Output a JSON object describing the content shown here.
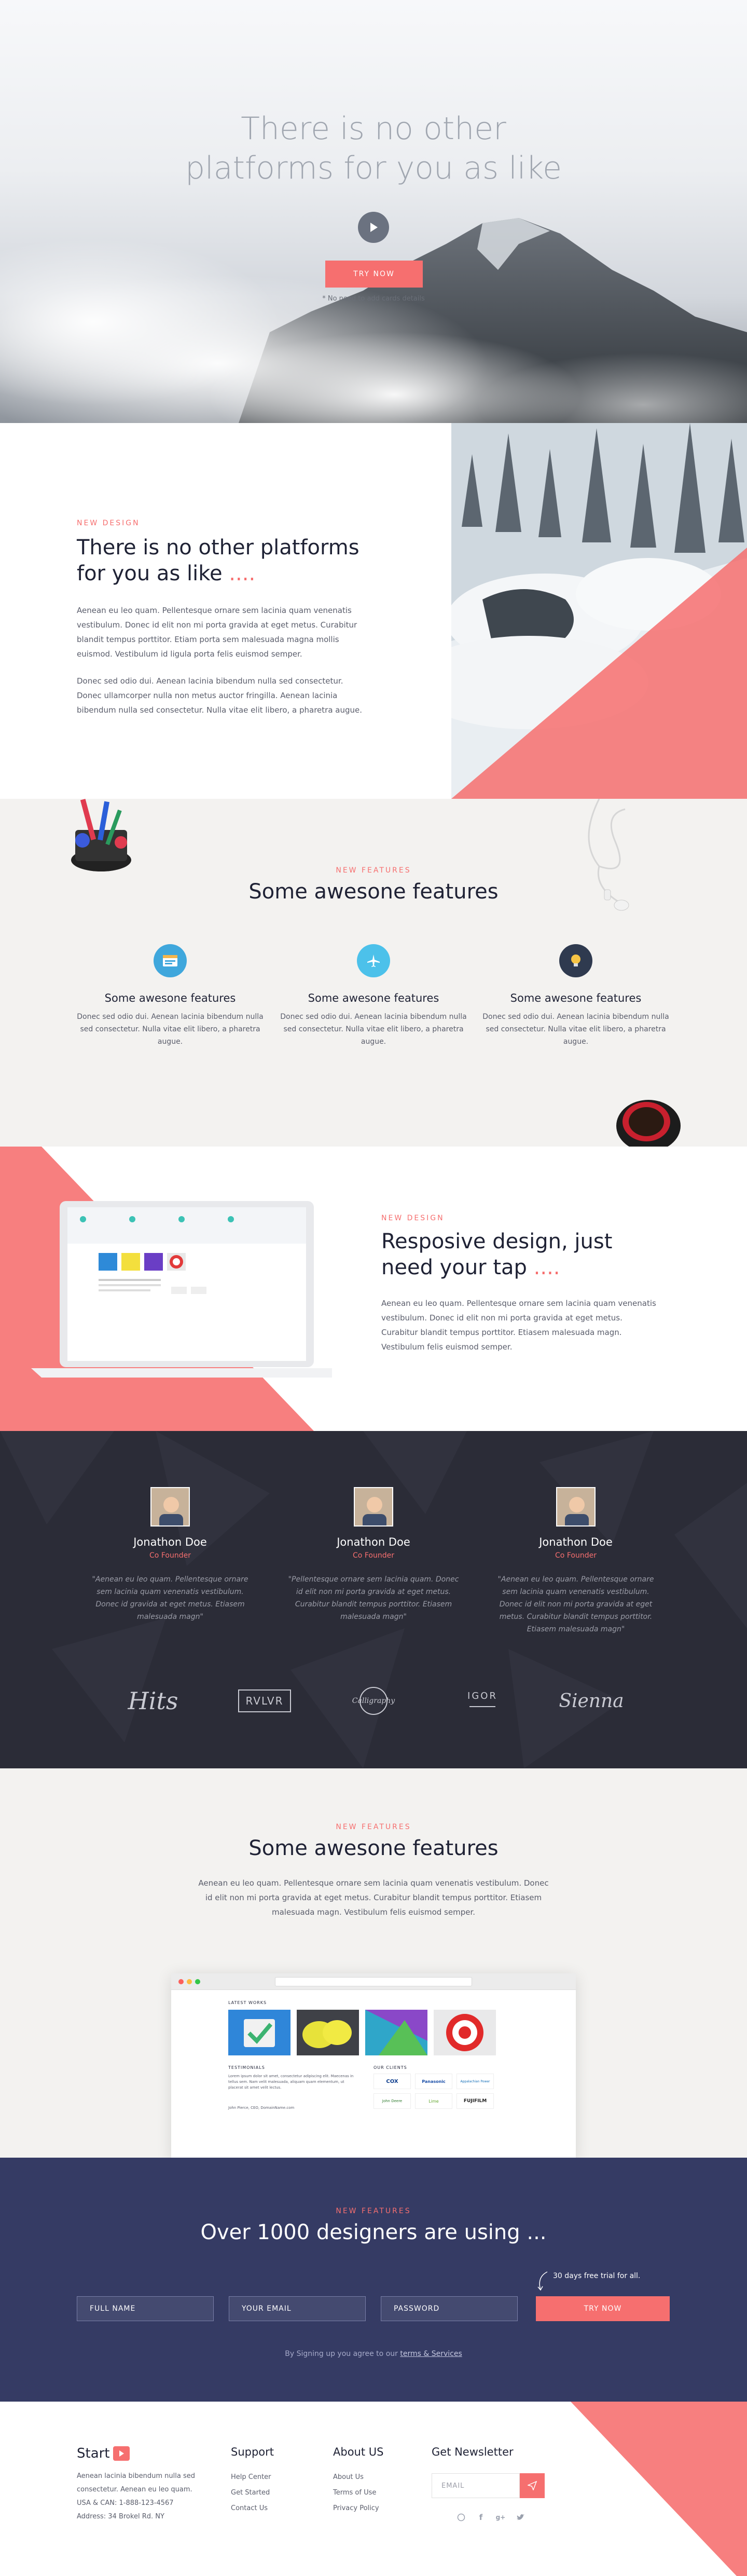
{
  "colors": {
    "accent": "#f66f6f",
    "dark": "#2b2c37",
    "navy": "#353b64",
    "light": "#f3f2f0"
  },
  "hero": {
    "title_line1": "There is no other",
    "title_line2": "platforms for you as like",
    "cta": "TRY NOW",
    "note": "* No need to add cards details"
  },
  "design": {
    "eyebrow": "NEW DESIGN",
    "title_line1": "There is no other platforms",
    "title_line2": "for you as like",
    "title_dots": "....",
    "p1": "Aenean eu leo quam. Pellentesque ornare sem lacinia quam venenatis vestibulum. Donec id elit non mi porta gravida at eget metus. Curabitur blandit tempus porttitor. Etiam porta sem malesuada magna mollis euismod. Vestibulum id ligula porta felis euismod semper.",
    "p2": "Donec sed odio dui. Aenean lacinia bibendum nulla sed consectetur. Donec ullamcorper nulla non metus auctor fringilla. Aenean lacinia bibendum nulla sed consectetur. Nulla vitae elit libero, a pharetra augue."
  },
  "features": {
    "eyebrow": "NEW FEATURES",
    "title": "Some awesone features",
    "items": [
      {
        "icon": "browser-icon",
        "title": "Some awesone features",
        "text": "Donec sed odio dui. Aenean lacinia bibendum nulla sed consectetur. Nulla vitae elit libero, a pharetra augue."
      },
      {
        "icon": "airplane-icon",
        "title": "Some awesone features",
        "text": "Donec sed odio dui. Aenean lacinia bibendum nulla sed consectetur. Nulla vitae elit libero, a pharetra augue."
      },
      {
        "icon": "lightbulb-icon",
        "title": "Some awesone features",
        "text": "Donec sed odio dui. Aenean lacinia bibendum nulla sed consectetur. Nulla vitae elit libero, a pharetra augue."
      }
    ]
  },
  "responsive": {
    "eyebrow": "NEW DESIGN",
    "title_line1": "Resposive design, just",
    "title_line2": "need your tap",
    "title_dots": "....",
    "text": "Aenean eu leo quam. Pellentesque ornare sem lacinia quam venenatis vestibulum. Donec id elit non mi porta gravida at eget metus. Curabitur blandit tempus porttitor. Etiasem malesuada magn. Vestibulum felis euismod semper."
  },
  "testimonials": {
    "items": [
      {
        "name": "Jonathon Doe",
        "role": "Co Founder",
        "quote": "\"Aenean eu leo quam. Pellentesque ornare sem lacinia quam venenatis vestibulum. Donec id gravida at eget metus. Etiasem malesuada magn\""
      },
      {
        "name": "Jonathon Doe",
        "role": "Co Founder",
        "quote": "\"Pellentesque ornare sem lacinia quam. Donec id elit non mi porta gravida at eget metus. Curabitur blandit tempus porttitor. Etiasem malesuada magn\""
      },
      {
        "name": "Jonathon Doe",
        "role": "Co Founder",
        "quote": "\"Aenean eu leo quam. Pellentesque ornare sem lacinia quam venenatis vestibulum. Donec id elit non mi porta gravida at eget metus. Curabitur blandit tempus porttitor. Etiasem malesuada magn\""
      }
    ],
    "logos": [
      "Hits",
      "RVLVR",
      "Calligraphy",
      "IGOR",
      "Sienna"
    ]
  },
  "showcase": {
    "eyebrow": "NEW FEATURES",
    "title": "Some awesone features",
    "desc": "Aenean eu leo quam. Pellentesque ornare sem lacinia quam venenatis vestibulum. Donec id elit non mi porta gravida at eget metus. Curabitur blandit tempus porttitor. Etiasem malesuada magn. Vestibulum felis euismod semper.",
    "latest": "LATEST WORKS",
    "testimonials": "TESTIMONIALS",
    "clients": "OUR CLIENTS",
    "quote": "Lorem ipsum dolor sit amet, consectetur adipiscing elit. Maecenas in tellus sem. Nam velit malesuada, aliquam quam elementum, ut placerat sit amet velit lectus.",
    "author": "John Pierce, CEO, DomainName.com",
    "brands": [
      "COX",
      "Panasonic",
      "Appalachian Power",
      "John Deere",
      "Lime",
      "FUJIFILM"
    ]
  },
  "signup": {
    "eyebrow": "NEW FEATURES",
    "title": "Over 1000 designers are using ...",
    "free": "30 days free trial for all.",
    "fullname": "FULL NAME",
    "email": "YOUR EMAIL",
    "password": "PASSWORD",
    "button": "TRY NOW",
    "agree_prefix": "By Signing up you agree to our",
    "agree_link": "terms & Services"
  },
  "footer": {
    "brand": "Start",
    "about": "Aenean lacinia bibendum nulla sed consectetur. Aenean eu leo quam. USA & CAN: 1-888-123-4567 Address: 34 Brokel Rd. NY",
    "support_title": "Support",
    "support_links": [
      "Help Center",
      "Get Started",
      "Contact Us"
    ],
    "aboutus_title": "About US",
    "aboutus_links": [
      "About Us",
      "Terms of Use",
      "Privacy Policy"
    ],
    "newsletter_title": "Get Newsletter",
    "email_placeholder": "EMAIL"
  }
}
